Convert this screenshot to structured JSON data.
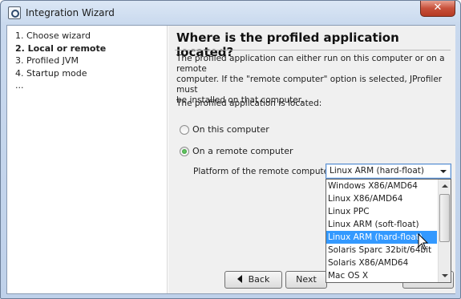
{
  "window": {
    "title": "Integration Wizard",
    "close_label": "✕"
  },
  "steps": [
    {
      "label": "1. Choose wizard",
      "active": false
    },
    {
      "label": "2. Local or remote",
      "active": true
    },
    {
      "label": "3. Profiled JVM",
      "active": false
    },
    {
      "label": "4. Startup mode",
      "active": false
    },
    {
      "label": "...",
      "active": false
    }
  ],
  "main": {
    "title": "Where is the profiled application located?",
    "description_lines": [
      "The profiled application can either run on this computer or on a remote",
      "computer. If the \"remote computer\" option is selected, JProfiler must",
      "be installed on that computer."
    ],
    "location_label": "The profiled application is located:",
    "radio_local": {
      "label": "On this computer",
      "checked": false
    },
    "radio_remote": {
      "label": "On a remote computer",
      "checked": true
    },
    "platform_label": "Platform of the remote computer:",
    "platform_value": "Linux ARM (hard-float)",
    "platform_options": [
      "Windows X86/AMD64",
      "Linux X86/AMD64",
      "Linux PPC",
      "Linux ARM (soft-float)",
      "Linux ARM (hard-float)",
      "Solaris Sparc 32bit/64bit",
      "Solaris X86/AMD64",
      "Mac OS X"
    ],
    "selected_index": 4
  },
  "buttons": {
    "back": "Back",
    "next": "Next"
  }
}
